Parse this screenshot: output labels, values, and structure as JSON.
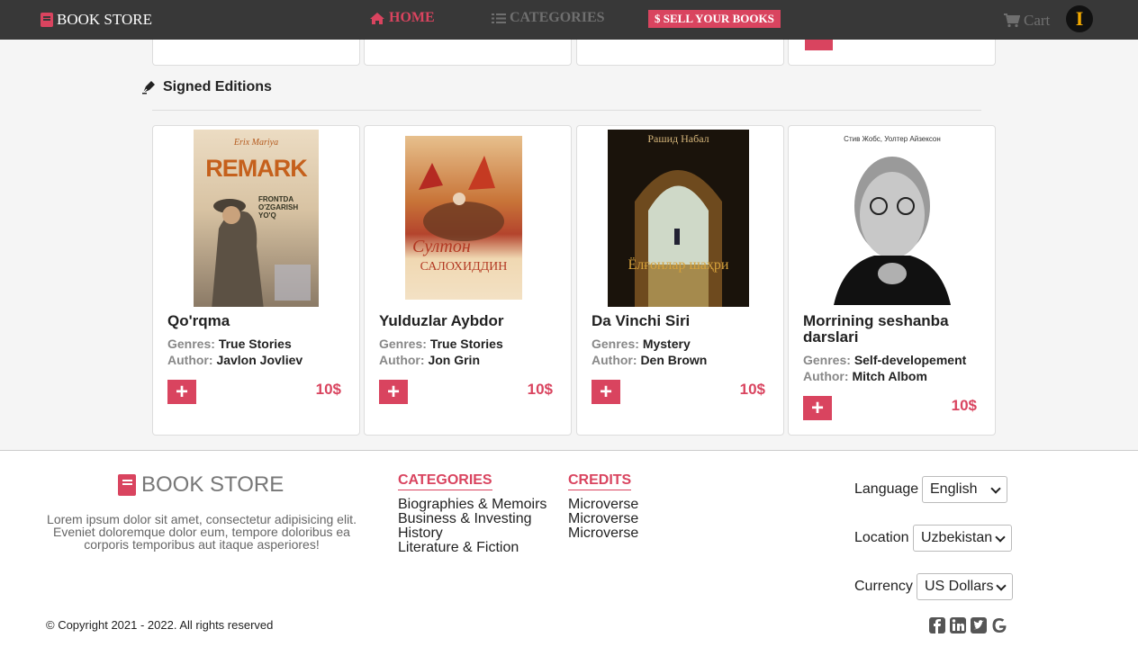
{
  "nav": {
    "brand": "BOOK STORE",
    "home": "HOME",
    "categories": "CATEGORIES",
    "sell": "SELL YOUR BOOKS",
    "cart": "Cart",
    "avatar_letter": "I"
  },
  "section": {
    "title": "Signed Editions"
  },
  "books": [
    {
      "title": "Qo'rqma",
      "genres_label": "Genres:",
      "genre": "True Stories",
      "author_label": "Author:",
      "author": "Javlon Jovliev",
      "price": "10$"
    },
    {
      "title": "Yulduzlar Aybdor",
      "genres_label": "Genres:",
      "genre": "True Stories",
      "author_label": "Author:",
      "author": "Jon Grin",
      "price": "10$"
    },
    {
      "title": "Da Vinchi Siri",
      "genres_label": "Genres:",
      "genre": "Mystery",
      "author_label": "Author:",
      "author": "Den Brown",
      "price": "10$"
    },
    {
      "title": "Morrining seshanba darslari",
      "genres_label": "Genres:",
      "genre": "Self-developement",
      "author_label": "Author:",
      "author": "Mitch Albom",
      "price": "10$"
    }
  ],
  "covers": {
    "c1_top": "Erix Mariya",
    "c1_big": "REMARK",
    "c1_sub": "FRONTDA O'ZGARISH YO'Q",
    "c2_script": "Султон",
    "c2_big": "САЛОХИДДИН",
    "c3_top": "Рашид Набал",
    "c3_big": "Ёлғонлар шаҳри",
    "c4_top": "Стив Жобс, Уолтер Айзексон"
  },
  "footer": {
    "brand": "BOOK STORE",
    "description": "Lorem ipsum dolor sit amet, consectetur adipisicing elit. Eveniet doloremque dolor eum, tempore doloribus ea corporis temporibus aut itaque asperiores!",
    "categories_title": "CATEGORIES",
    "categories": [
      "Biographies & Memoirs",
      "Business & Investing",
      "History",
      "Literature & Fiction"
    ],
    "credits_title": "CREDITS",
    "credits": [
      "Microverse",
      "Microverse",
      "Microverse"
    ],
    "language_label": "Language",
    "language_value": "English",
    "location_label": "Location",
    "location_value": "Uzbekistan",
    "currency_label": "Currency",
    "currency_value": "US Dollars",
    "copyright": "© Copyright 2021 - 2022. All rights reserved",
    "social_icons": [
      "facebook-icon",
      "linkedin-icon",
      "twitter-icon",
      "google-icon"
    ]
  },
  "colors": {
    "accent": "#d9445f",
    "navbar": "#383838"
  }
}
